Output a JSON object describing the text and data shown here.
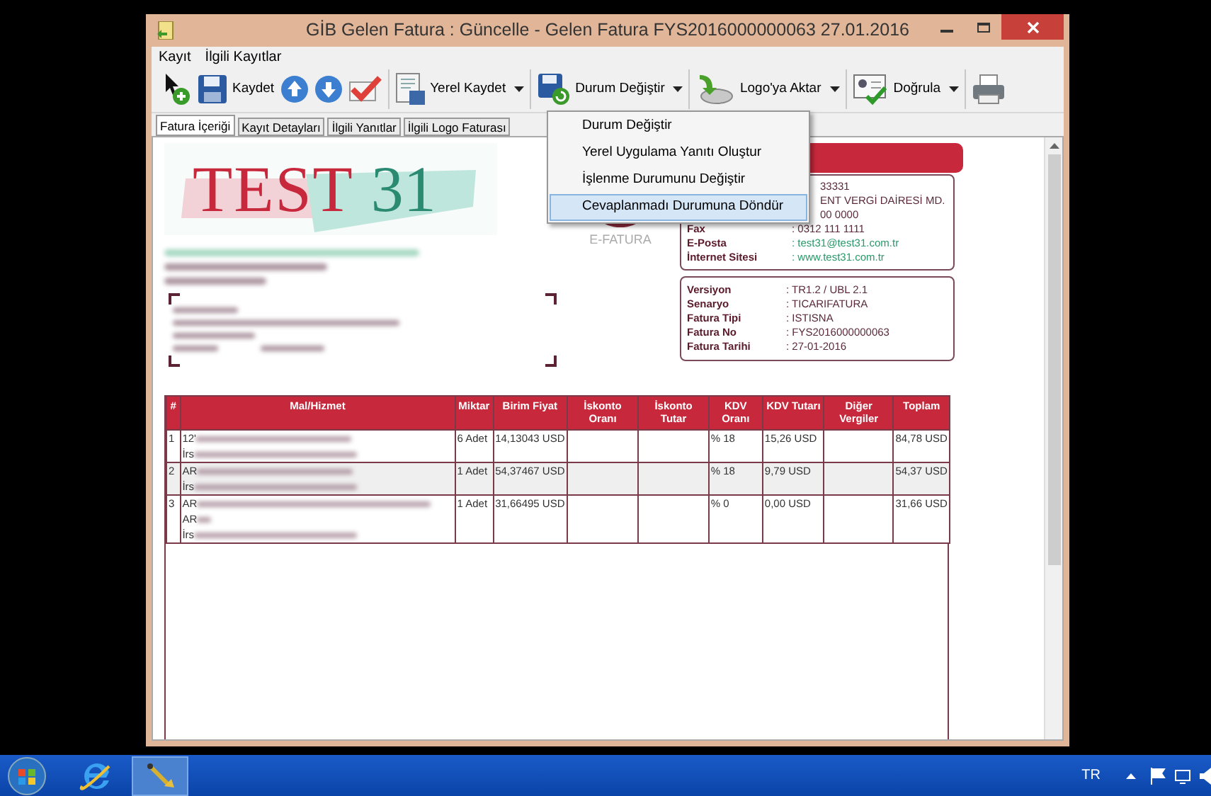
{
  "window": {
    "title": "GİB Gelen Fatura : Güncelle - Gelen Fatura FYS2016000000063 27.01.2016"
  },
  "menu": [
    "Kayıt",
    "İlgili Kayıtlar"
  ],
  "toolbar": [
    {
      "kind": "new"
    },
    {
      "kind": "save",
      "label": "Kaydet"
    },
    {
      "kind": "up"
    },
    {
      "kind": "down"
    },
    {
      "kind": "approve"
    },
    {
      "kind": "local-save",
      "label": "Yerel Kaydet",
      "dropdown": true
    },
    {
      "kind": "status",
      "label": "Durum Değiştir",
      "dropdown": true
    },
    {
      "kind": "export",
      "label": "Logo'ya Aktar",
      "dropdown": true
    },
    {
      "kind": "verify",
      "label": "Doğrula",
      "dropdown": true
    },
    {
      "kind": "print"
    }
  ],
  "tabs": [
    {
      "label": "Fatura İçeriği",
      "selected": true
    },
    {
      "label": "Kayıt Detayları",
      "selected": false
    },
    {
      "label": "İlgili Yanıtlar",
      "selected": false
    },
    {
      "label": "İlgili Logo Faturası",
      "selected": false
    }
  ],
  "dropdown_menu": [
    {
      "label": "Durum Değiştir",
      "selected": false
    },
    {
      "label": "Yerel Uygulama Yanıtı Oluştur",
      "selected": false
    },
    {
      "label": "İşlenme Durumunu Değiştir",
      "selected": false
    },
    {
      "label": "Cevaplanmadı Durumuna Döndür",
      "selected": true
    }
  ],
  "document": {
    "logo": {
      "word": "TEST",
      "number": "31"
    },
    "stamp": {
      "caption": "E-FATURA"
    },
    "company_box": [
      {
        "kind": "partial",
        "value": "33331"
      },
      {
        "kind": "partial",
        "value": "ENT VERGİ DAİRESİ MD."
      },
      {
        "kind": "partial",
        "value": "00 0000"
      },
      {
        "kind": "field",
        "label": "Fax",
        "value": ": 0312 111 1111"
      },
      {
        "kind": "link",
        "label": "E-Posta",
        "value": ": test31@test31.com.tr"
      },
      {
        "kind": "link",
        "label": "İnternet Sitesi",
        "value": ": www.test31.com.tr"
      }
    ],
    "invoice_box": [
      {
        "label": "Versiyon",
        "value": ": TR1.2 / UBL 2.1"
      },
      {
        "label": "Senaryo",
        "value": ": TICARIFATURA"
      },
      {
        "label": "Fatura Tipi",
        "value": ": ISTISNA"
      },
      {
        "label": "Fatura No",
        "value": ": FYS2016000000063"
      },
      {
        "label": "Fatura Tarihi",
        "value": ": 27-01-2016"
      }
    ],
    "table": {
      "columns": [
        "#",
        "Mal/Hizmet",
        "Miktar",
        "Birim Fiyat",
        "İskonto Oranı",
        "İskonto Tutar",
        "KDV Oranı",
        "KDV Tutarı",
        "Diğer Vergiler",
        "Toplam"
      ],
      "rows": [
        {
          "no": "1",
          "item": [
            "12'",
            "İrs"
          ],
          "qty": "6 Adet",
          "price": "14,13043 USD",
          "vat_rate": "% 18",
          "vat": "15,26 USD",
          "total": "84,78 USD"
        },
        {
          "no": "2",
          "item": [
            "AR",
            "İrs"
          ],
          "qty": "1 Adet",
          "price": "54,37467 USD",
          "vat_rate": "% 18",
          "vat": "9,79 USD",
          "total": "54,37 USD"
        },
        {
          "no": "3",
          "item": [
            "AR",
            "AR",
            "İrs"
          ],
          "qty": "1 Adet",
          "price": "31,66495 USD",
          "vat_rate": "% 0",
          "vat": "0,00 USD",
          "total": "31,66 USD"
        }
      ]
    }
  },
  "taskbar": {
    "language": "TR"
  }
}
